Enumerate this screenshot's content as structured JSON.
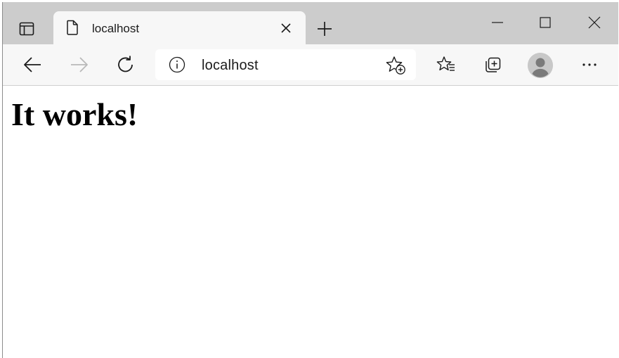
{
  "tab": {
    "title": "localhost"
  },
  "address_bar": {
    "url": "localhost"
  },
  "page": {
    "heading": "It works!"
  },
  "icons": {
    "tab_actions": "tab-actions-icon",
    "page": "page-icon",
    "close_tab": "close-icon",
    "new_tab": "plus-icon",
    "minimize": "minimize-icon",
    "maximize": "maximize-icon",
    "close_window": "close-icon",
    "back": "arrow-left-icon",
    "forward": "arrow-right-icon",
    "refresh": "refresh-icon",
    "site_info": "info-icon",
    "add_favorite": "star-add-icon",
    "favorites": "favorites-icon",
    "collections": "collections-icon",
    "profile": "avatar-icon",
    "menu": "more-icon"
  },
  "colors": {
    "tabstrip": "#cccccc",
    "toolbar": "#f7f7f7",
    "icon": "#1b1b1b",
    "disabled_icon": "#b9b9b9"
  }
}
